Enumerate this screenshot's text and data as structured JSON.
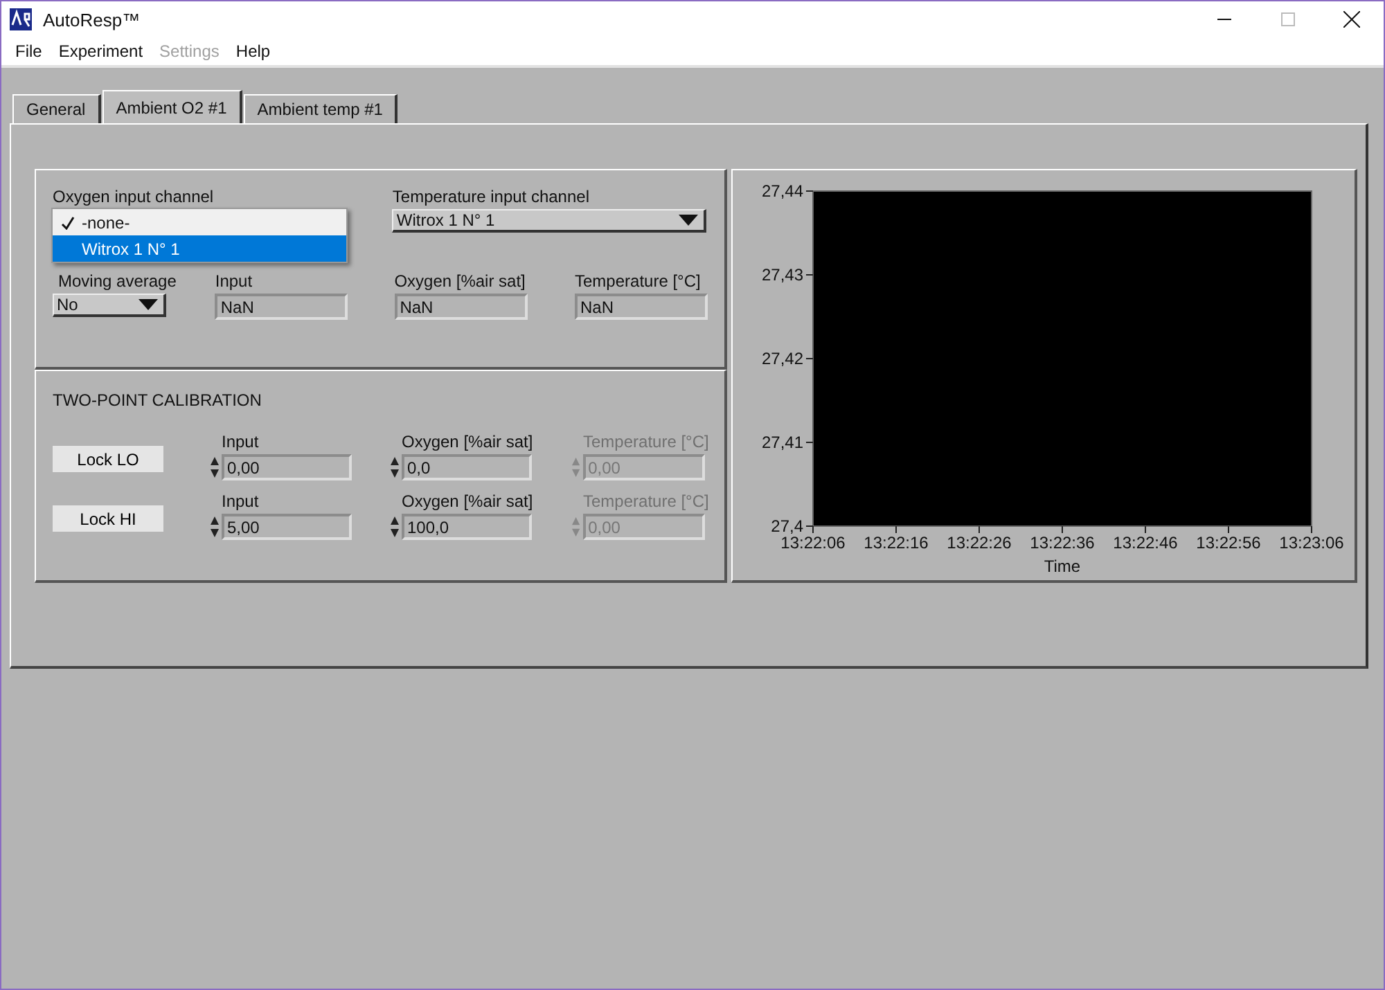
{
  "window": {
    "title": "AutoResp™"
  },
  "menu": [
    {
      "label": "File",
      "disabled": false
    },
    {
      "label": "Experiment",
      "disabled": false
    },
    {
      "label": "Settings",
      "disabled": true
    },
    {
      "label": "Help",
      "disabled": false
    }
  ],
  "tabs": [
    {
      "label": "General",
      "selected": false
    },
    {
      "label": "Ambient O2 #1",
      "selected": true
    },
    {
      "label": "Ambient temp #1",
      "selected": false
    }
  ],
  "channels": {
    "oxygen": {
      "label": "Oxygen input channel",
      "menu": [
        {
          "label": "-none-",
          "checked": true,
          "highlighted": false
        },
        {
          "label": "Witrox 1 N° 1",
          "checked": false,
          "highlighted": true
        }
      ]
    },
    "temperature": {
      "label": "Temperature input channel",
      "value": "Witrox 1 N° 1"
    },
    "moving_average": {
      "label": "Moving average",
      "value": "No"
    },
    "readings": [
      {
        "label": "Input",
        "value": "NaN"
      },
      {
        "label": "Oxygen [%air sat]",
        "value": "NaN"
      },
      {
        "label": "Temperature [°C]",
        "value": "NaN"
      }
    ]
  },
  "calibration": {
    "title": "TWO-POINT CALIBRATION",
    "rows": [
      {
        "button": "Lock LO",
        "fields": [
          {
            "label": "Input",
            "value": "0,00",
            "disabled": false
          },
          {
            "label": "Oxygen [%air sat]",
            "value": "0,0",
            "disabled": false
          },
          {
            "label": "Temperature [°C]",
            "value": "0,00",
            "disabled": true
          }
        ]
      },
      {
        "button": "Lock HI",
        "fields": [
          {
            "label": "Input",
            "value": "5,00",
            "disabled": false
          },
          {
            "label": "Oxygen [%air sat]",
            "value": "100,0",
            "disabled": false
          },
          {
            "label": "Temperature [°C]",
            "value": "0,00",
            "disabled": true
          }
        ]
      }
    ]
  },
  "graph": {
    "chart_data": {
      "type": "line",
      "xlabel": "Time",
      "ylim": [
        27.4,
        27.44
      ],
      "categories": [
        "13:22:06",
        "13:22:16",
        "13:22:26",
        "13:22:36",
        "13:22:46",
        "13:22:56",
        "13:23:06"
      ],
      "yticks": [
        {
          "value": 27.44,
          "label": "27,44"
        },
        {
          "value": 27.43,
          "label": "27,43"
        },
        {
          "value": 27.42,
          "label": "27,42"
        },
        {
          "value": 27.41,
          "label": "27,41"
        },
        {
          "value": 27.4,
          "label": "27,4"
        }
      ]
    }
  }
}
